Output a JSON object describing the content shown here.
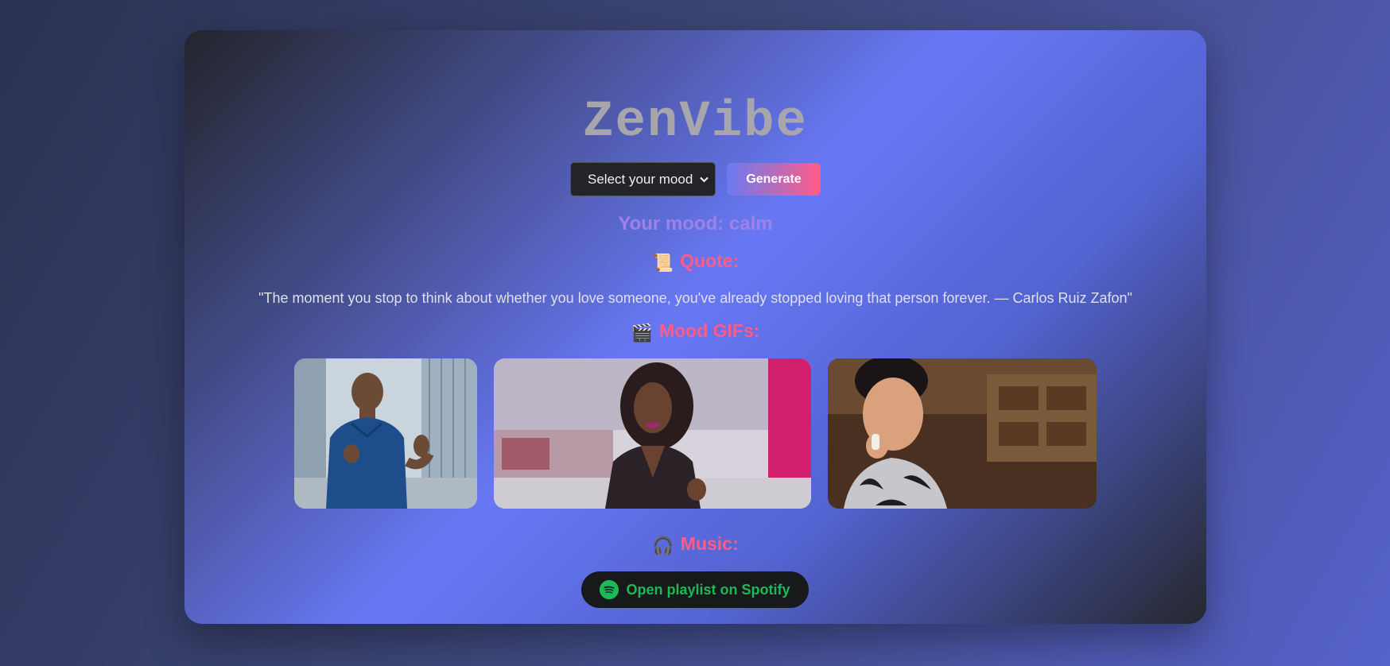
{
  "app": {
    "title": "ZenVibe"
  },
  "controls": {
    "mood_select_value": "Select your mood",
    "generate_label": "Generate"
  },
  "mood": {
    "text": "Your mood: calm"
  },
  "quote_section": {
    "emoji": "📜",
    "heading": "Quote:",
    "text": "\"The moment you stop to think about whether you love someone, you've already stopped loving that person forever. — Carlos Ruiz Zafon\""
  },
  "gifs_section": {
    "emoji": "🎬",
    "heading": "Mood GIFs:"
  },
  "music_section": {
    "emoji": "🎧",
    "heading": "Music:",
    "spotify_label": "Open playlist on Spotify"
  },
  "colors": {
    "accent_pink": "#ff5c86",
    "mood_purple": "#9d82e8",
    "spotify_green": "#1db954"
  }
}
